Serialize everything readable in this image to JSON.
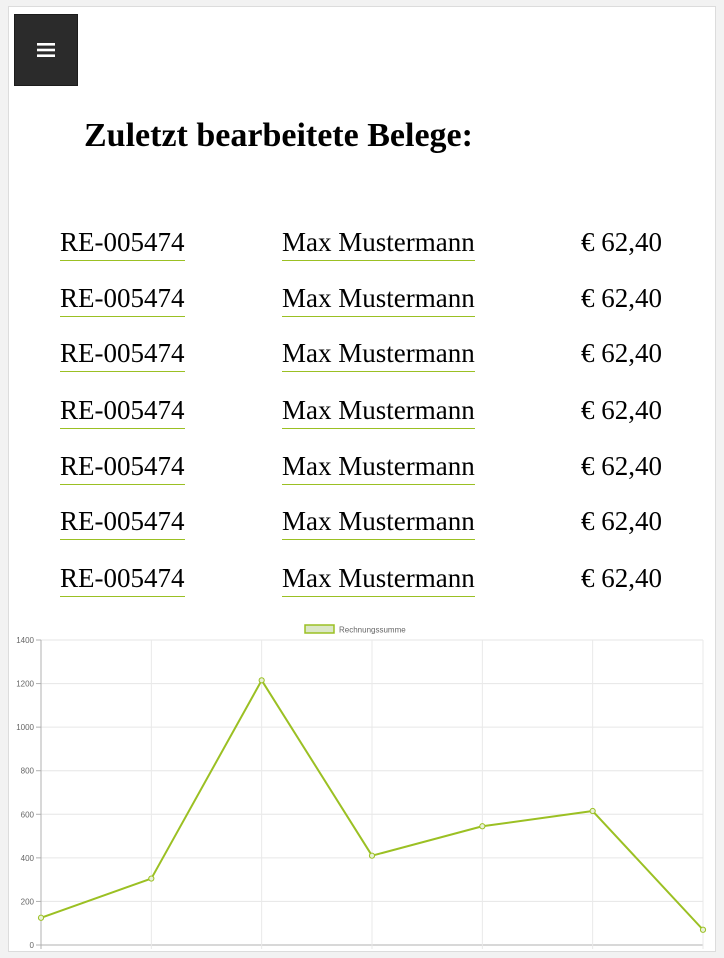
{
  "menu": {
    "icon": "hamburger-menu-icon"
  },
  "title": "Zuletzt bearbeitete Belege:",
  "documents": [
    {
      "number": "RE-005474",
      "customer": "Max Mustermann",
      "amount": "€ 62,40"
    },
    {
      "number": "RE-005474",
      "customer": "Max Mustermann",
      "amount": "€ 62,40"
    },
    {
      "number": "RE-005474",
      "customer": "Max Mustermann",
      "amount": "€ 62,40"
    },
    {
      "number": "RE-005474",
      "customer": "Max Mustermann",
      "amount": "€ 62,40"
    },
    {
      "number": "RE-005474",
      "customer": "Max Mustermann",
      "amount": "€ 62,40"
    },
    {
      "number": "RE-005474",
      "customer": "Max Mustermann",
      "amount": "€ 62,40"
    },
    {
      "number": "RE-005474",
      "customer": "Max Mustermann",
      "amount": "€ 62,40"
    }
  ],
  "colors": {
    "accent": "#9bc023",
    "legend_fill": "#dbe7c7",
    "menu_bg": "#2b2b2b"
  },
  "chart_data": {
    "type": "line",
    "title": "",
    "xlabel": "",
    "ylabel": "",
    "legend": "top",
    "grid": true,
    "ylim": [
      0,
      1400
    ],
    "yticks": [
      0,
      200,
      400,
      600,
      800,
      1000,
      1200,
      1400
    ],
    "series": [
      {
        "name": "Rechnungssumme",
        "values": [
          125,
          305,
          1215,
          410,
          545,
          615,
          70
        ]
      }
    ]
  }
}
